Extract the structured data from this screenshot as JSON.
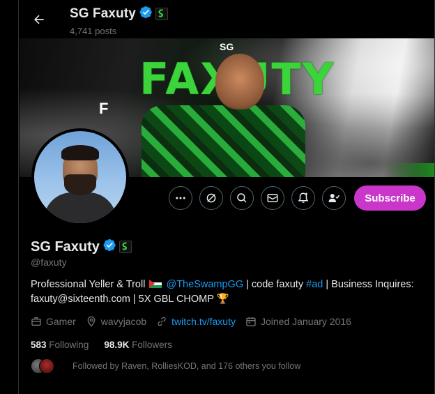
{
  "header": {
    "name": "SG Faxuty",
    "posts": "4,741 posts"
  },
  "banner": {
    "title": "FAXUTY",
    "tag": "SG",
    "side_letter": "F"
  },
  "actions": {
    "subscribe_label": "Subscribe"
  },
  "profile": {
    "name": "SG Faxuty",
    "handle": "@faxuty",
    "bio_text_1": "Professional Yeller & Troll",
    "bio_mention": "@TheSwampGG",
    "bio_text_2": " | code faxuty ",
    "bio_hashtag": "#ad",
    "bio_text_3": " | Business Inquires: faxuty@sixteenth.com | 5X GBL CHOMP",
    "bio_emoji": "🏆",
    "category": "Gamer",
    "location": "wavyjacob",
    "website": "twitch.tv/faxuty",
    "joined": "Joined January 2016",
    "following_count": "583",
    "following_label": "Following",
    "followers_count": "98.9K",
    "followers_label": "Followers",
    "followed_by": "Followed by Raven, RolliesKOD, and 176 others you follow"
  },
  "colors": {
    "accent": "#1d9bf0",
    "subscribe": "#c936c9",
    "muted": "#71767b",
    "text": "#e7e9ea",
    "background": "#000000"
  }
}
